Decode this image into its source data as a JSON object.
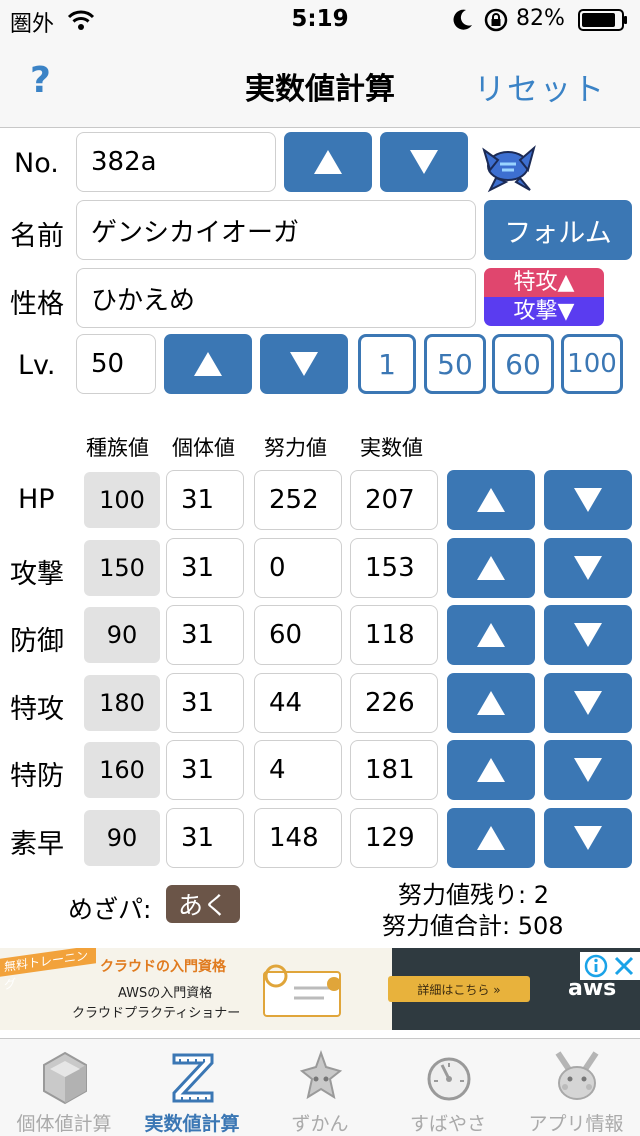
{
  "status_bar": {
    "carrier": "圏外",
    "time": "5:19",
    "battery": "82%"
  },
  "nav": {
    "help": "?",
    "title": "実数値計算",
    "reset": "リセット"
  },
  "form": {
    "no_label": "No.",
    "no_value": "382a",
    "name_label": "名前",
    "name_value": "ゲンシカイオーガ",
    "form_button": "フォルム",
    "nature_label": "性格",
    "nature_value": "ひかえめ",
    "nature_up": "特攻▲",
    "nature_down": "攻撃▼",
    "lv_label": "Lv.",
    "lv_value": "50",
    "lv_presets": [
      "1",
      "50",
      "60",
      "100"
    ]
  },
  "stats_header": {
    "base": "種族値",
    "iv": "個体値",
    "ev": "努力値",
    "actual": "実数値"
  },
  "stats": [
    {
      "label": "HP",
      "base": "100",
      "iv": "31",
      "ev": "252",
      "actual": "207"
    },
    {
      "label": "攻撃",
      "base": "150",
      "iv": "31",
      "ev": "0",
      "actual": "153"
    },
    {
      "label": "防御",
      "base": "90",
      "iv": "31",
      "ev": "60",
      "actual": "118"
    },
    {
      "label": "特攻",
      "base": "180",
      "iv": "31",
      "ev": "44",
      "actual": "226"
    },
    {
      "label": "特防",
      "base": "160",
      "iv": "31",
      "ev": "4",
      "actual": "181"
    },
    {
      "label": "素早",
      "base": "90",
      "iv": "31",
      "ev": "148",
      "actual": "129"
    }
  ],
  "summary": {
    "mezapa_label": "めざパ:",
    "mezapa_type": "あく",
    "ev_remaining": "努力値残り: 2",
    "ev_total": "努力値合計: 508"
  },
  "ad": {
    "ribbon": "無料トレーニング",
    "title": "クラウドの入門資格",
    "line1": "AWSの入門資格",
    "line2": "クラウドプラクティショナー",
    "cta": "詳細はこちら »",
    "brand": "aws"
  },
  "tabs": [
    {
      "label": "個体値計算",
      "icon": "cube-icon",
      "active": false
    },
    {
      "label": "実数値計算",
      "icon": "ruler-z-icon",
      "active": true
    },
    {
      "label": "ずかん",
      "icon": "pokedex-icon",
      "active": false
    },
    {
      "label": "すばやさ",
      "icon": "speedometer-icon",
      "active": false
    },
    {
      "label": "アプリ情報",
      "icon": "pikachu-icon",
      "active": false
    }
  ],
  "colors": {
    "accent": "#3b77b4",
    "nature_up": "#e0466e",
    "nature_down": "#5a3cf0",
    "mezapa": "#6b5548"
  }
}
